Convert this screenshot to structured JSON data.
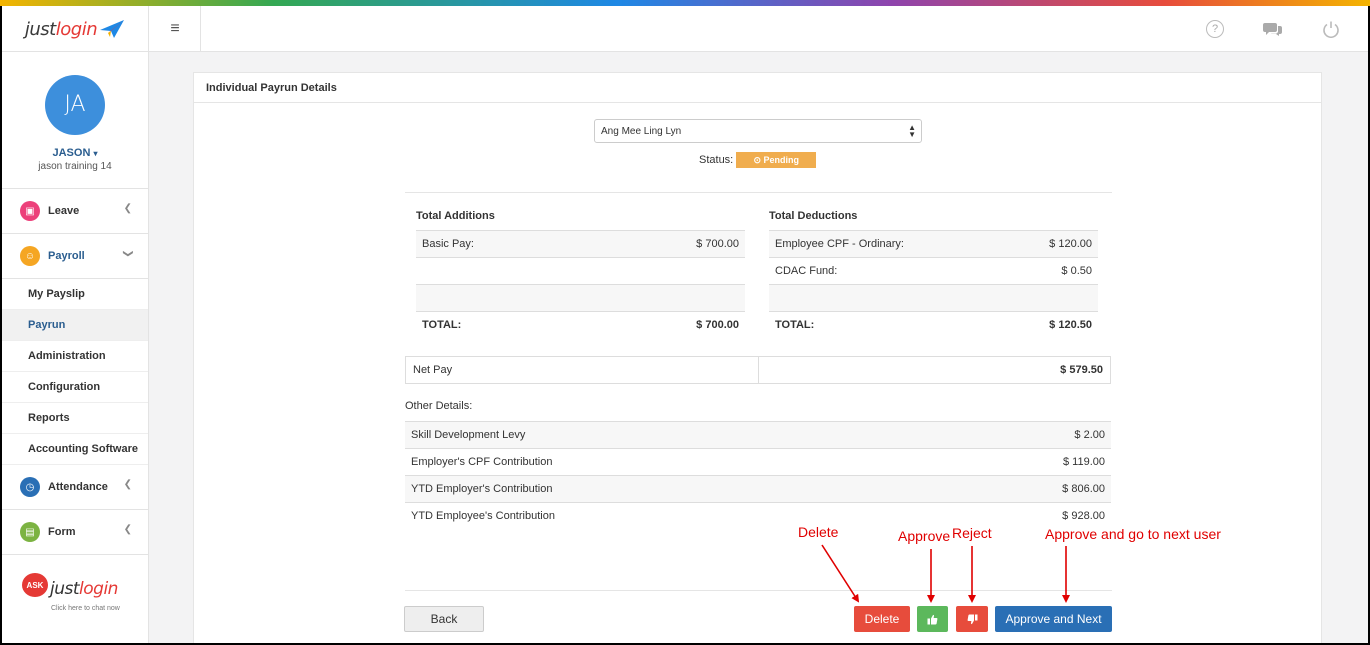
{
  "app": {
    "logo_text_a": "just",
    "logo_text_b": "login"
  },
  "topbar": {
    "menu_icon": "hamburger-icon",
    "help_glyph": "?",
    "chat_icon": "chat-icon",
    "power_icon": "power-icon"
  },
  "profile": {
    "initials": "JA",
    "name": "JASON",
    "subtitle": "jason training 14"
  },
  "sidebar": {
    "leave": "Leave",
    "payroll": "Payroll",
    "sub_items": [
      "My Payslip",
      "Payrun",
      "Administration",
      "Configuration",
      "Reports",
      "Accounting Software"
    ],
    "attendance": "Attendance",
    "form": "Form",
    "ask_badge": "ASK",
    "ask_brand_a": "just",
    "ask_brand_b": "login",
    "ask_sub": "Click here to chat now"
  },
  "panel": {
    "title": "Individual Payrun Details",
    "employee": "Ang Mee Ling Lyn",
    "status_label": "Status:",
    "status_value": "⊙ Pending"
  },
  "additions": {
    "title": "Total Additions",
    "rows": [
      {
        "label": "Basic Pay:",
        "value": "$ 700.00"
      }
    ],
    "total_label": "TOTAL:",
    "total_value": "$ 700.00"
  },
  "deductions": {
    "title": "Total Deductions",
    "rows": [
      {
        "label": "Employee CPF - Ordinary:",
        "value": "$ 120.00"
      },
      {
        "label": "CDAC Fund:",
        "value": "$ 0.50"
      }
    ],
    "total_label": "TOTAL:",
    "total_value": "$ 120.50"
  },
  "netpay": {
    "label": "Net Pay",
    "value": "$ 579.50"
  },
  "other": {
    "label": "Other Details:",
    "rows": [
      {
        "label": "Skill Development Levy",
        "value": "$ 2.00"
      },
      {
        "label": "Employer's CPF Contribution",
        "value": "$ 119.00"
      },
      {
        "label": "YTD Employer's Contribution",
        "value": "$ 806.00"
      },
      {
        "label": "YTD Employee's Contribution",
        "value": "$ 928.00"
      }
    ]
  },
  "buttons": {
    "back": "Back",
    "delete": "Delete",
    "approve_icon": "thumbs-up-icon",
    "reject_icon": "thumbs-down-icon",
    "next": "Approve and Next"
  },
  "annotations": {
    "delete": "Delete",
    "approve": "Approve",
    "reject": "Reject",
    "next": "Approve and go to next user"
  },
  "colors": {
    "accent": "#2a6fb5",
    "danger": "#e74c3c",
    "success": "#5cb85c",
    "warning": "#f0ad4e",
    "annotation": "#e00000"
  }
}
